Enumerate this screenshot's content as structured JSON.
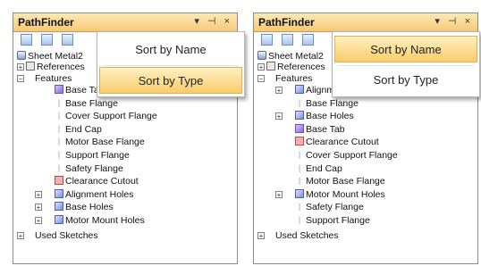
{
  "panels": [
    {
      "title": "PathFinder",
      "controls": "▾ ⊣ ×",
      "root": "Sheet Metal2",
      "references": "References",
      "features_label": "Features",
      "features": [
        {
          "label": "Base Tab",
          "icon": "tab",
          "expand": false
        },
        {
          "label": "Base Flange",
          "icon": "flange",
          "expand": false
        },
        {
          "label": "Cover Support Flange",
          "icon": "flange",
          "expand": false
        },
        {
          "label": "End Cap",
          "icon": "flange",
          "expand": false
        },
        {
          "label": "Motor Base Flange",
          "icon": "flange",
          "expand": false
        },
        {
          "label": "Support Flange",
          "icon": "flange",
          "expand": false
        },
        {
          "label": "Safety Flange",
          "icon": "flange",
          "expand": false
        },
        {
          "label": "Clearance Cutout",
          "icon": "cut",
          "expand": false
        },
        {
          "label": "Alignment Holes",
          "icon": "hole",
          "expand": true
        },
        {
          "label": "Base Holes",
          "icon": "hole",
          "expand": true
        },
        {
          "label": "Motor Mount Holes",
          "icon": "hole",
          "expand": true
        }
      ],
      "used_sketches": "Used Sketches",
      "menu": {
        "item1": "Sort by Name",
        "item2": "Sort by Type",
        "highlighted": "Sort by Type"
      }
    },
    {
      "title": "PathFinder",
      "controls": "▾ ⊣ ×",
      "root": "Sheet Metal2",
      "references": "References",
      "features_label": "Features",
      "features": [
        {
          "label": "Alignment Holes",
          "icon": "hole",
          "expand": true
        },
        {
          "label": "Base Flange",
          "icon": "flange",
          "expand": false
        },
        {
          "label": "Base Holes",
          "icon": "hole",
          "expand": true
        },
        {
          "label": "Base Tab",
          "icon": "tab",
          "expand": false
        },
        {
          "label": "Clearance Cutout",
          "icon": "cut",
          "expand": false
        },
        {
          "label": "Cover Support Flange",
          "icon": "flange",
          "expand": false
        },
        {
          "label": "End Cap",
          "icon": "flange",
          "expand": false
        },
        {
          "label": "Motor Base Flange",
          "icon": "flange",
          "expand": false
        },
        {
          "label": "Motor Mount Holes",
          "icon": "hole",
          "expand": true
        },
        {
          "label": "Safety Flange",
          "icon": "flange",
          "expand": false
        },
        {
          "label": "Support Flange",
          "icon": "flange",
          "expand": false
        }
      ],
      "used_sketches": "Used Sketches",
      "menu": {
        "item1": "Sort by Name",
        "item2": "Sort by Type",
        "highlighted": "Sort by Name"
      }
    }
  ],
  "colors": {
    "title_bar": "#f6c877",
    "menu_highlight": "#f9cc6a"
  }
}
